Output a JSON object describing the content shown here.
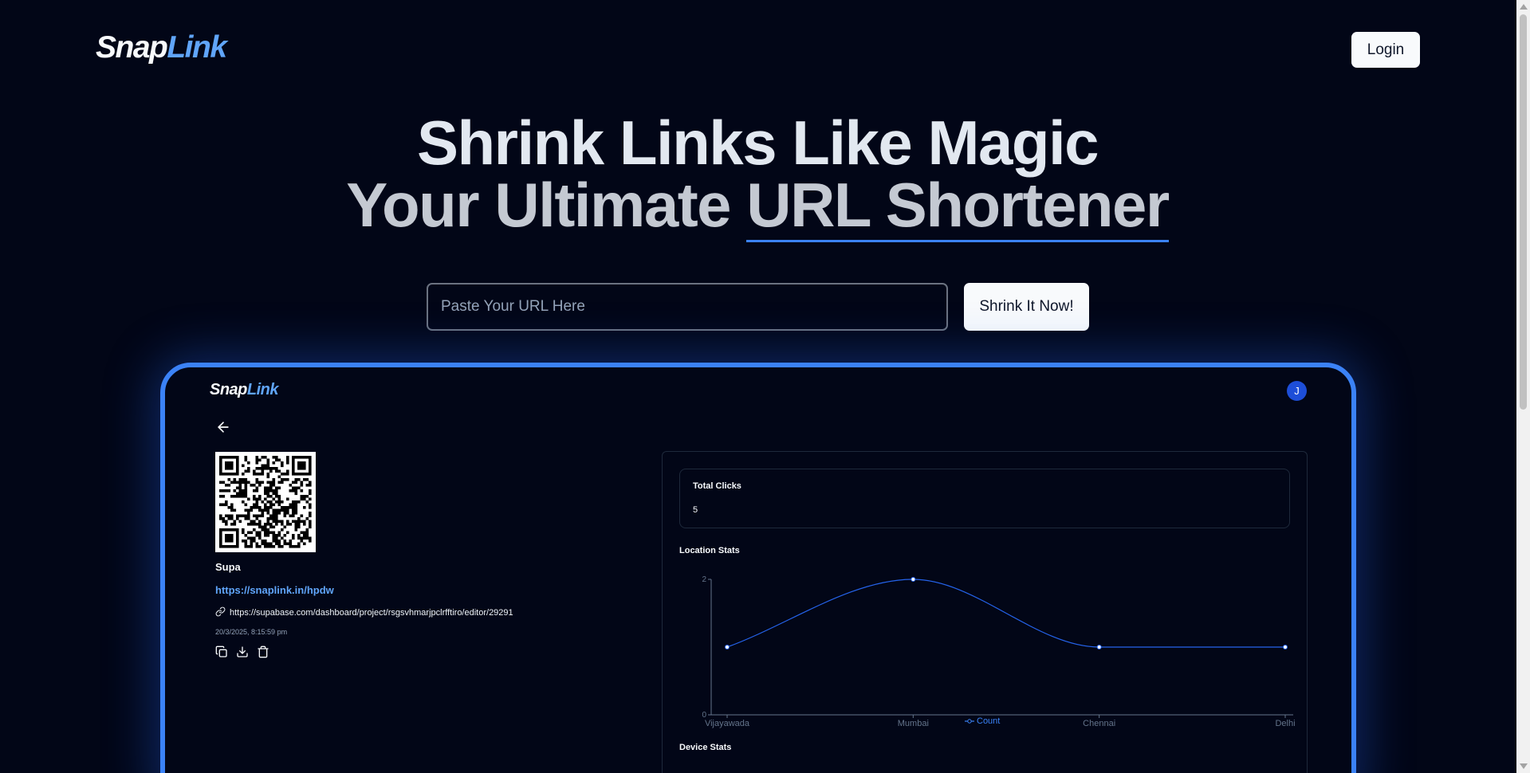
{
  "header": {
    "logo_part1": "Snap",
    "logo_part2": "Link",
    "login_label": "Login"
  },
  "hero": {
    "line1": "Shrink Links Like Magic",
    "line2_prefix": "Your Ultimate ",
    "line2_underlined": "URL Shortener"
  },
  "shrink_form": {
    "placeholder": "Paste Your URL Here",
    "value": "",
    "button_label": "Shrink It Now!"
  },
  "preview": {
    "logo_part1": "Snap",
    "logo_part2": "Link",
    "avatar_initial": "J",
    "link": {
      "title": "Supa",
      "short_url": "https://snaplink.in/hpdw",
      "long_url": "https://supabase.com/dashboard/project/rsgsvhmarjpclrfftiro/editor/29291",
      "created_at": "20/3/2025, 8:15:59 pm"
    },
    "stats": {
      "total_clicks_label": "Total Clicks",
      "total_clicks_value": "5",
      "location_title": "Location Stats",
      "device_title": "Device Stats"
    }
  },
  "icons": {
    "back": "arrow-left-icon",
    "link": "link-icon",
    "copy": "copy-icon",
    "download": "download-icon",
    "delete": "trash-icon"
  },
  "colors": {
    "background": "#020617",
    "accent": "#3b82f6",
    "logo_accent": "#60a5fa"
  },
  "chart_data": {
    "type": "line",
    "categories": [
      "Vijayawada",
      "Mumbai",
      "Chennai",
      "Delhi"
    ],
    "series": [
      {
        "name": "Count",
        "values": [
          1,
          2,
          1,
          1
        ]
      }
    ],
    "y_ticks": [
      "0",
      "2"
    ],
    "ylim": [
      0,
      2
    ],
    "grid": false,
    "legend": "bottom-center"
  }
}
